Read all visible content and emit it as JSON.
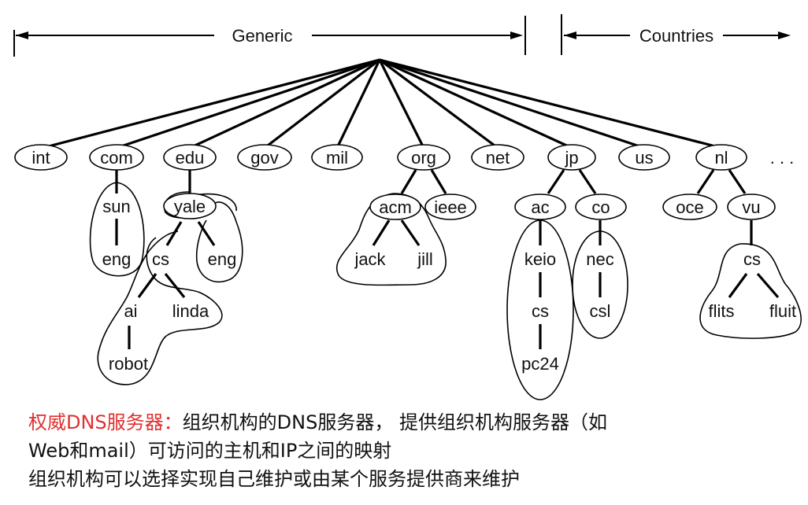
{
  "header": {
    "generic_label": "Generic",
    "countries_label": "Countries"
  },
  "root": "",
  "top_level_domains": [
    "int",
    "com",
    "edu",
    "gov",
    "mil",
    "org",
    "net",
    "jp",
    "us",
    "nl"
  ],
  "ellipsis": ". . .",
  "subdomains": {
    "sun": "sun",
    "eng_sun": "eng",
    "yale": "yale",
    "eng_yale": "eng",
    "cs_yale": "cs",
    "ai": "ai",
    "linda": "linda",
    "robot": "robot",
    "acm": "acm",
    "ieee": "ieee",
    "jack": "jack",
    "jill": "jill",
    "ac": "ac",
    "co": "co",
    "keio": "keio",
    "cs_keio": "cs",
    "pc24": "pc24",
    "nec": "nec",
    "csl": "csl",
    "oce": "oce",
    "vu": "vu",
    "cs_vu": "cs",
    "flits": "flits",
    "fluit": "fluit"
  },
  "caption": {
    "line1_highlight": "权威DNS服务器：",
    "line1_rest": "组织机构的DNS服务器， 提供组织机构服务器（如",
    "line2": "Web和mail）可访问的主机和IP之间的映射",
    "line3": "组织机构可以选择实现自己维护或由某个服务提供商来维护"
  }
}
